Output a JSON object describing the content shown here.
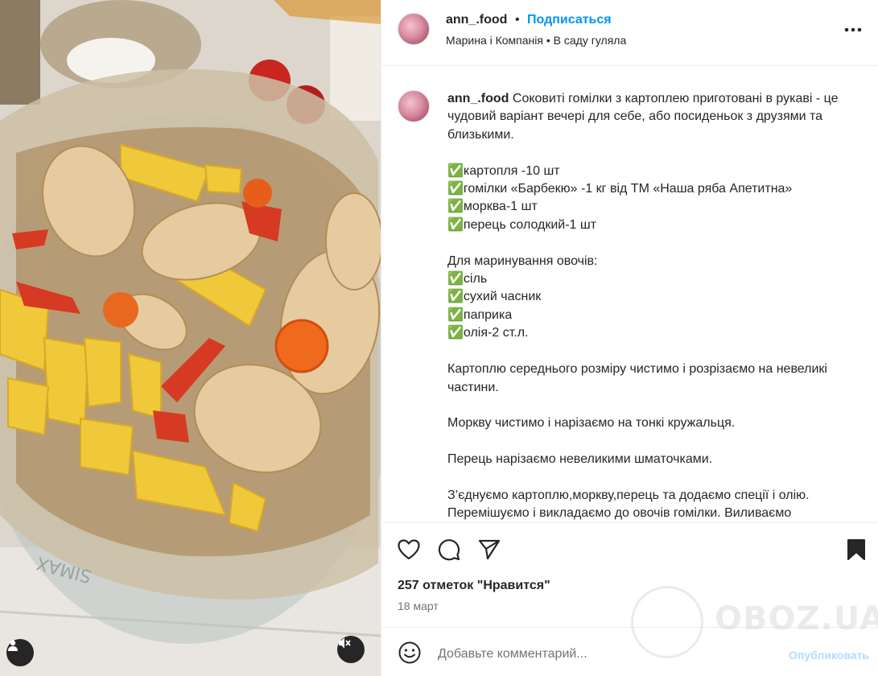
{
  "header": {
    "username": "ann_.food",
    "dot": "•",
    "follow_label": "Подписаться",
    "music": "Марина і Компанія • В саду гуляла"
  },
  "caption": {
    "username": "ann_.food",
    "text": " Соковиті гомілки з картоплею приготовані в рукаві - це чудовий варіант вечері для себе, або посиденьок з друзями та близькими.\n\n✅картопля -10 шт\n✅гомілки «Барбекю» -1 кг від ТМ «Наша ряба Апетитна»\n✅морква-1 шт\n✅перець солодкий-1 шт\n\nДля маринування овочів:\n✅сіль\n✅сухий часник\n✅паприка\n✅олія-2 ст.л.\n\nКартоплю середнього розміру чистимо і розрізаємо на невеликі частини.\n\nМоркву чистимо і нарізаємо на тонкі кружальця.\n\nПерець нарізаємо невеликими шматочками.\n\nЗ’єднуємо картоплю,моркву,перець та додаємо спеції і олію. Перемішуємо і викладаємо до овочів гомілки. Виливаємо"
  },
  "actions": {
    "like_icon": "heart-icon",
    "comment_icon": "comment-icon",
    "share_icon": "paper-plane-icon",
    "save_icon": "bookmark-icon"
  },
  "likes": "257 отметок \"Нравится\"",
  "date": "18 март",
  "comment": {
    "placeholder": "Добавьте комментарий...",
    "publish_label": "Опубликовать"
  },
  "watermark": {
    "text": "OBOZ.UA"
  },
  "media": {
    "glass_brand": "SIMAX"
  },
  "colors": {
    "accent": "#0095f6",
    "publish_disabled": "#b3dbff",
    "text": "#262626",
    "muted": "#737373"
  }
}
